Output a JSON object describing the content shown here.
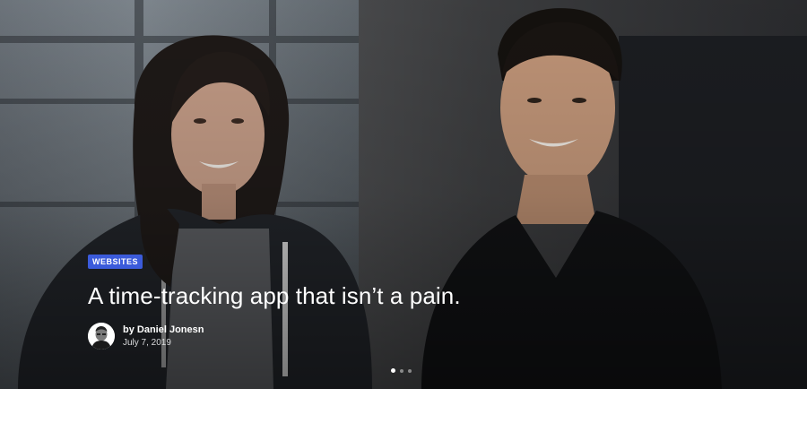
{
  "hero": {
    "category": "WEBSITES",
    "title": "A time-tracking app that isn’t a pain.",
    "author": {
      "prefix": "by",
      "name": "by Daniel Jonesn"
    },
    "date": "July 7, 2019",
    "slides": {
      "count": 3,
      "active": 1
    }
  },
  "colors": {
    "badge": "#3b5bdb",
    "title": "#ffffff",
    "date": "#d9dadc",
    "page_bg": "#ffffff"
  },
  "icons": {
    "avatar": "author-avatar-photo"
  }
}
